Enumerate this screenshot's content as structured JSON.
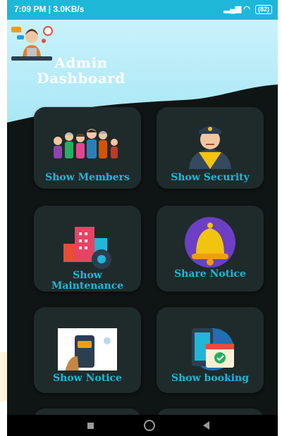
{
  "statusbar": {
    "left": "7:09 PM | 3.0KB/s",
    "battery": "(82)"
  },
  "header": {
    "title": "Admin Dashboard"
  },
  "tiles": [
    {
      "label": "Show Members",
      "icon": "family-icon"
    },
    {
      "label": "Show Security",
      "icon": "security-guard-icon"
    },
    {
      "label": "Show Maintenance",
      "icon": "maintenance-icon"
    },
    {
      "label": "Share Notice",
      "icon": "bell-icon"
    },
    {
      "label": "Show Notice",
      "icon": "phone-notice-icon"
    },
    {
      "label": "Show booking",
      "icon": "booking-calendar-icon"
    }
  ],
  "colors": {
    "accent": "#1fb7d8",
    "tile": "#1f2a2b",
    "background": "#0f1514",
    "header_light": "#bfeef9"
  }
}
